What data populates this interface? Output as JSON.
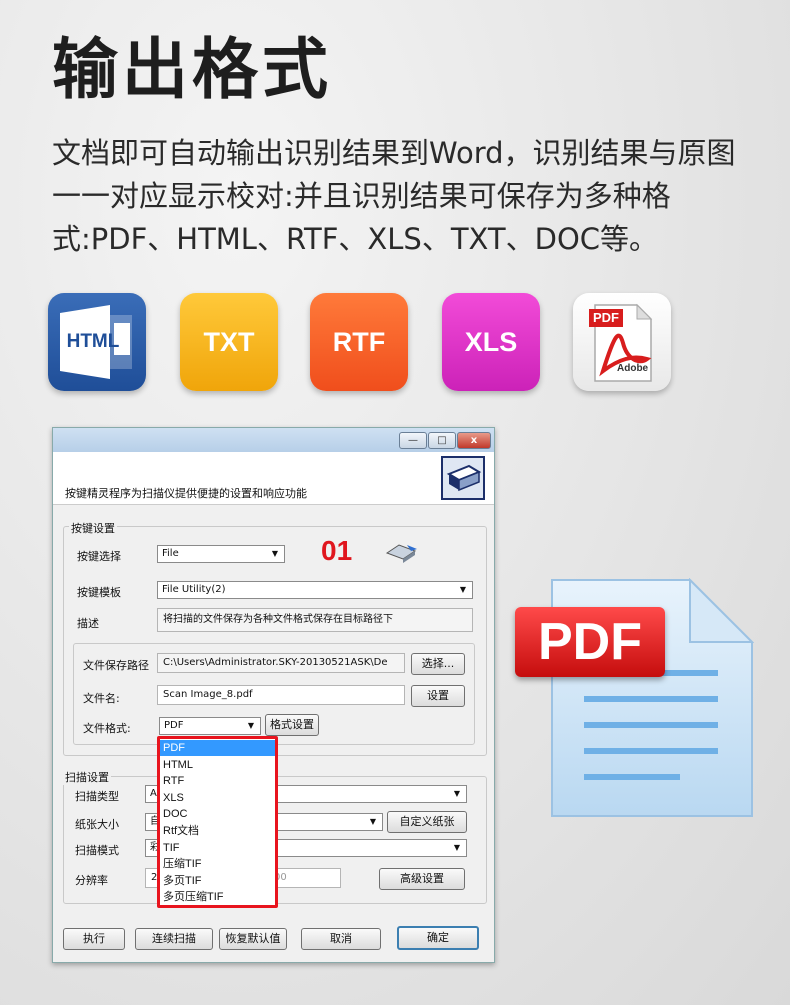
{
  "headline": "输出格式",
  "description": "文档即可自动输出识别结果到Word，识别结果与原图一一对应显示校对:并且识别结果可保存为多种格式:PDF、HTML、RTF、XLS、TXT、DOC等。",
  "format_icons": {
    "html": "HTML",
    "txt": "TXT",
    "rtf": "RTF",
    "xls": "XLS",
    "pdf_top": "PDF",
    "pdf_bottom": "Adobe"
  },
  "window": {
    "controls": {
      "minimize": "—",
      "maximize": "□",
      "close": "x"
    },
    "header_text": "按键精灵程序为扫描仪提供便捷的设置和响应功能",
    "key_group": {
      "title": "按键设置",
      "key_select_label": "按键选择",
      "key_select_value": "File",
      "key_number": "01",
      "template_label": "按键模板",
      "template_value": "File Utility(2)",
      "desc_label": "描述",
      "desc_value": "将扫描的文件保存为各种文件格式保存在目标路径下",
      "save_path_label": "文件保存路径",
      "save_path_value": "C:\\Users\\Administrator.SKY-20130521ASK\\De",
      "browse_button": "选择...",
      "file_name_label": "文件名:",
      "file_name_value": "Scan Image_8.pdf",
      "settings_button": "设置",
      "format_label": "文件格式:",
      "format_value": "PDF",
      "format_settings_button": "格式设置",
      "format_options": [
        "PDF",
        "HTML",
        "RTF",
        "XLS",
        "DOC",
        "Rtf文档",
        "TIF",
        "压缩TIF",
        "多页TIF",
        "多页压缩TIF"
      ]
    },
    "scan_group": {
      "title": "扫描设置",
      "scan_type_label": "扫描类型",
      "scan_type_value": "A",
      "paper_size_label": "纸张大小",
      "paper_size_value": "自",
      "custom_paper_button": "自定义纸张",
      "scan_mode_label": "扫描模式",
      "scan_mode_value": "彩",
      "resolution_label": "分辨率",
      "resolution_value": "2",
      "resolution_right_value": "00",
      "advanced_button": "高级设置"
    },
    "buttons": {
      "execute": "执行",
      "continuous": "连续扫描",
      "restore": "恢复默认值",
      "cancel": "取消",
      "ok": "确定"
    }
  },
  "pdf_badge": "PDF"
}
